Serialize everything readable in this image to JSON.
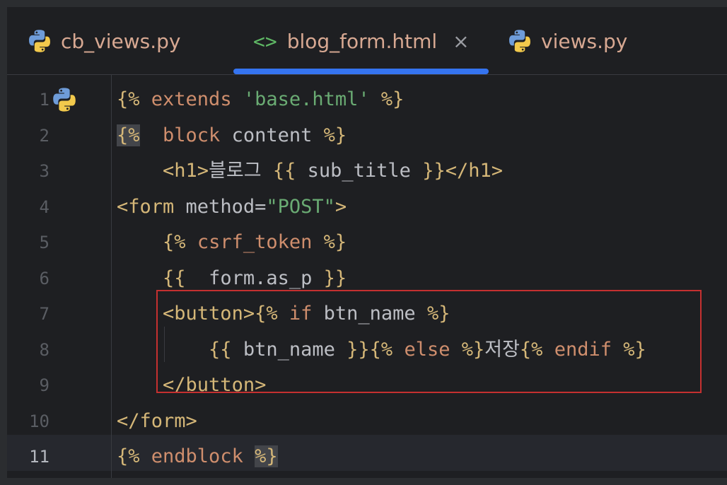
{
  "tabs": [
    {
      "label": "cb_views.py",
      "icon": "python-icon",
      "active": false
    },
    {
      "label": "blog_form.html",
      "icon": "html-icon",
      "icon_text": "<>",
      "active": true,
      "close": "×"
    },
    {
      "label": "views.py",
      "icon": "python-icon",
      "active": false
    }
  ],
  "colors": {
    "accent": "#3574f0",
    "highlight_box": "#c53030",
    "tag": "#d5b778",
    "keyword": "#cf8e6d",
    "string": "#6aab73",
    "text": "#bcbec4"
  },
  "editor": {
    "current_line": 11,
    "line_numbers": [
      "1",
      "2",
      "3",
      "4",
      "5",
      "6",
      "7",
      "8",
      "9",
      "10",
      "11"
    ],
    "lines": [
      [
        {
          "t": "{% ",
          "c": "t"
        },
        {
          "t": "extends ",
          "c": "kw"
        },
        {
          "t": "'base.html'",
          "c": "str"
        },
        {
          "t": " %}",
          "c": "t"
        }
      ],
      [
        {
          "t": "{%",
          "c": "t brace-hl"
        },
        {
          "t": "  ",
          "c": "var"
        },
        {
          "t": "block ",
          "c": "kw"
        },
        {
          "t": "content ",
          "c": "var"
        },
        {
          "t": "%}",
          "c": "t"
        }
      ],
      [
        {
          "t": "    ",
          "c": "var"
        },
        {
          "t": "<h1>",
          "c": "t"
        },
        {
          "t": "블로그 ",
          "c": "var"
        },
        {
          "t": "{{ ",
          "c": "t"
        },
        {
          "t": "sub_title ",
          "c": "var"
        },
        {
          "t": "}}",
          "c": "t"
        },
        {
          "t": "</h1>",
          "c": "t"
        }
      ],
      [
        {
          "t": "<form ",
          "c": "t"
        },
        {
          "t": "method=",
          "c": "var"
        },
        {
          "t": "\"POST\"",
          "c": "str"
        },
        {
          "t": ">",
          "c": "t"
        }
      ],
      [
        {
          "t": "    ",
          "c": "var"
        },
        {
          "t": "{% ",
          "c": "t"
        },
        {
          "t": "csrf_token ",
          "c": "kw"
        },
        {
          "t": "%}",
          "c": "t"
        }
      ],
      [
        {
          "t": "    ",
          "c": "var"
        },
        {
          "t": "{{  ",
          "c": "t"
        },
        {
          "t": "form.as_p ",
          "c": "var"
        },
        {
          "t": "}}",
          "c": "t"
        }
      ],
      [
        {
          "t": "    ",
          "c": "var"
        },
        {
          "t": "<button>",
          "c": "t"
        },
        {
          "t": "{% ",
          "c": "t"
        },
        {
          "t": "if ",
          "c": "kw"
        },
        {
          "t": "btn_name ",
          "c": "var"
        },
        {
          "t": "%}",
          "c": "t"
        }
      ],
      [
        {
          "t": "        ",
          "c": "var"
        },
        {
          "t": "{{ ",
          "c": "t"
        },
        {
          "t": "btn_name ",
          "c": "var"
        },
        {
          "t": "}}",
          "c": "t"
        },
        {
          "t": "{% ",
          "c": "t"
        },
        {
          "t": "else ",
          "c": "kw"
        },
        {
          "t": "%}",
          "c": "t"
        },
        {
          "t": "저장",
          "c": "var"
        },
        {
          "t": "{% ",
          "c": "t"
        },
        {
          "t": "endif ",
          "c": "kw"
        },
        {
          "t": "%}",
          "c": "t"
        }
      ],
      [
        {
          "t": "    ",
          "c": "var"
        },
        {
          "t": "</button>",
          "c": "t"
        }
      ],
      [
        {
          "t": "</form>",
          "c": "t"
        }
      ],
      [
        {
          "t": "{% ",
          "c": "t"
        },
        {
          "t": "endblock ",
          "c": "kw"
        },
        {
          "t": "%}",
          "c": "t brace-hl"
        }
      ]
    ]
  }
}
